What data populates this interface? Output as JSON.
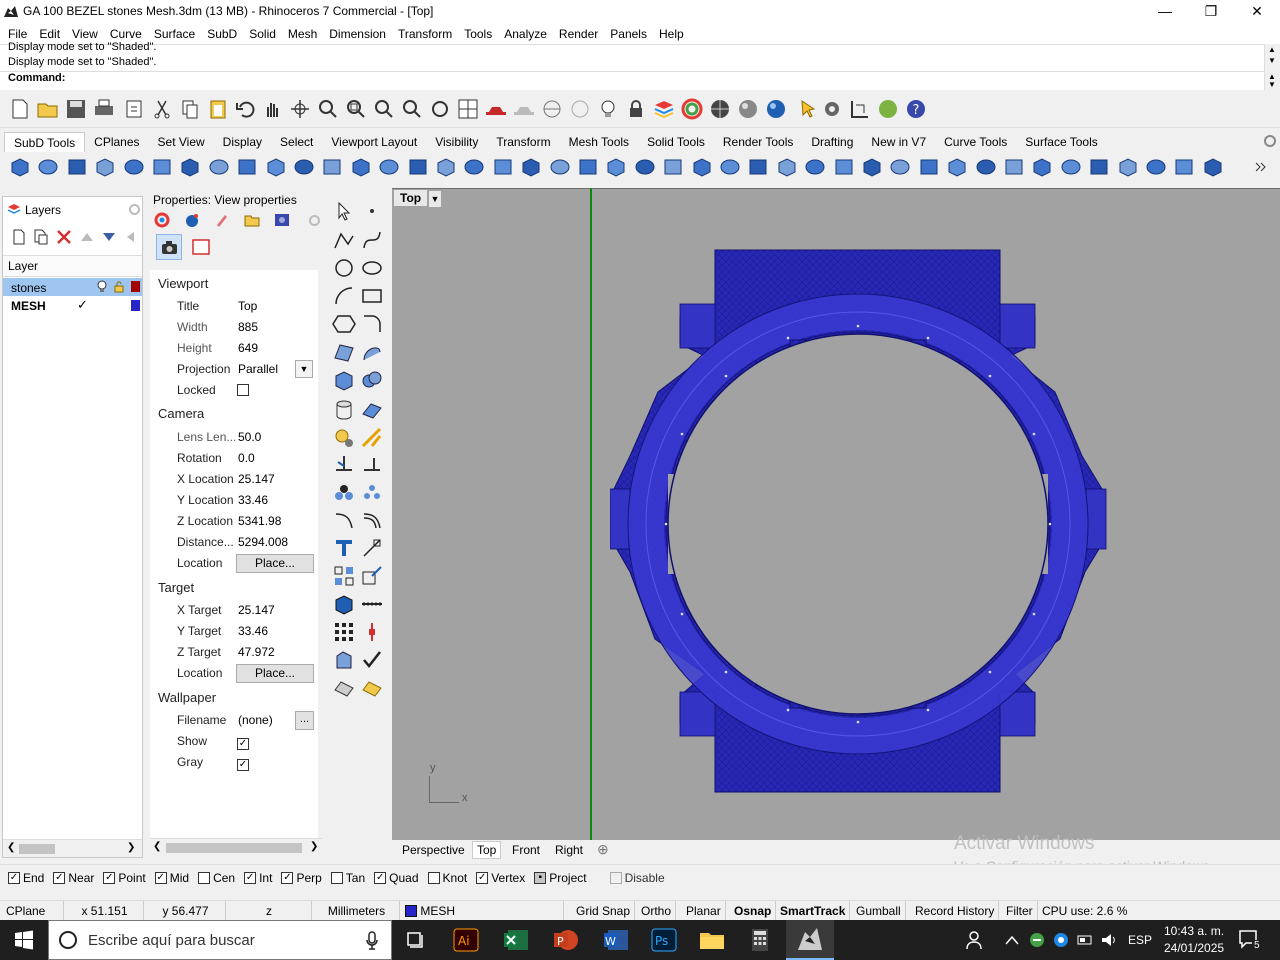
{
  "window": {
    "title": "GA 100 BEZEL stones Mesh.3dm (13 MB) - Rhinoceros 7 Commercial - [Top]",
    "minimize": "—",
    "restore": "❐",
    "close": "✕"
  },
  "menu": [
    "File",
    "Edit",
    "View",
    "Curve",
    "Surface",
    "SubD",
    "Solid",
    "Mesh",
    "Dimension",
    "Transform",
    "Tools",
    "Analyze",
    "Render",
    "Panels",
    "Help"
  ],
  "command": {
    "history": [
      "Display mode set to \"Shaded\".",
      "Display mode set to \"Shaded\"."
    ],
    "label": "Command:"
  },
  "toolbar_tabs": [
    "SubD Tools",
    "CPlanes",
    "Set View",
    "Display",
    "Select",
    "Viewport Layout",
    "Visibility",
    "Transform",
    "Mesh Tools",
    "Solid Tools",
    "Render Tools",
    "Drafting",
    "New in V7",
    "Curve Tools",
    "Surface Tools"
  ],
  "layers": {
    "tab": "Layers",
    "column": "Layer",
    "rows": [
      {
        "name": "stones",
        "selected": true,
        "color": "#a30000"
      },
      {
        "name": "MESH",
        "current": true,
        "check": "✓",
        "color": "#2424c8"
      }
    ]
  },
  "properties": {
    "title": "Properties: View properties",
    "viewport": {
      "heading": "Viewport",
      "title_label": "Title",
      "title_value": "Top",
      "width_label": "Width",
      "width_value": "885",
      "height_label": "Height",
      "height_value": "649",
      "projection_label": "Projection",
      "projection_value": "Parallel",
      "locked_label": "Locked",
      "locked": false
    },
    "camera": {
      "heading": "Camera",
      "lens_label": "Lens Len...",
      "lens_value": "50.0",
      "rotation_label": "Rotation",
      "rotation_value": "0.0",
      "xloc_label": "X Location",
      "xloc_value": "25.147",
      "yloc_label": "Y Location",
      "yloc_value": "33.46",
      "zloc_label": "Z Location",
      "zloc_value": "5341.98",
      "distance_label": "Distance...",
      "distance_value": "5294.008",
      "location_label": "Location",
      "place_label": "Place..."
    },
    "target": {
      "heading": "Target",
      "xt_label": "X Target",
      "xt_value": "25.147",
      "yt_label": "Y Target",
      "yt_value": "33.46",
      "zt_label": "Z Target",
      "zt_value": "47.972",
      "location_label": "Location",
      "place_label": "Place..."
    },
    "wallpaper": {
      "heading": "Wallpaper",
      "filename_label": "Filename",
      "filename_value": "(none)",
      "browse": "...",
      "show_label": "Show",
      "show": true,
      "gray_label": "Gray",
      "gray": true
    }
  },
  "viewport": {
    "label": "Top",
    "axis_y": "y",
    "axis_x": "x",
    "mesh_color": "#2a2ab4",
    "background": "#a2a2a2"
  },
  "viewport_tabs": [
    "Perspective",
    "Top",
    "Front",
    "Right"
  ],
  "active_viewport_tab": "Top",
  "watermark": {
    "line1": "Activar Windows",
    "line2": "Ve a Configuración para activar Windows."
  },
  "osnaps": [
    {
      "label": "End",
      "checked": true
    },
    {
      "label": "Near",
      "checked": true
    },
    {
      "label": "Point",
      "checked": true
    },
    {
      "label": "Mid",
      "checked": true
    },
    {
      "label": "Cen",
      "checked": false
    },
    {
      "label": "Int",
      "checked": true
    },
    {
      "label": "Perp",
      "checked": true
    },
    {
      "label": "Tan",
      "checked": false
    },
    {
      "label": "Quad",
      "checked": true
    },
    {
      "label": "Knot",
      "checked": false
    },
    {
      "label": "Vertex",
      "checked": true
    },
    {
      "label": "Project",
      "checked": false
    },
    {
      "label": "Disable",
      "checked": false
    }
  ],
  "status": {
    "cplane": "CPlane",
    "x": "x 51.151",
    "y": "y 56.477",
    "z": "z",
    "units": "Millimeters",
    "layer": "MESH",
    "grid_snap": "Grid Snap",
    "ortho": "Ortho",
    "planar": "Planar",
    "osnap": "Osnap",
    "smarttrack": "SmartTrack",
    "gumball": "Gumball",
    "record_history": "Record History",
    "filter": "Filter",
    "cpu": "CPU use: 2.6 %"
  },
  "taskbar": {
    "search_placeholder": "Escribe aquí para buscar",
    "lang": "ESP",
    "time": "10:43 a. m.",
    "date": "24/01/2025",
    "notifications": "5"
  }
}
